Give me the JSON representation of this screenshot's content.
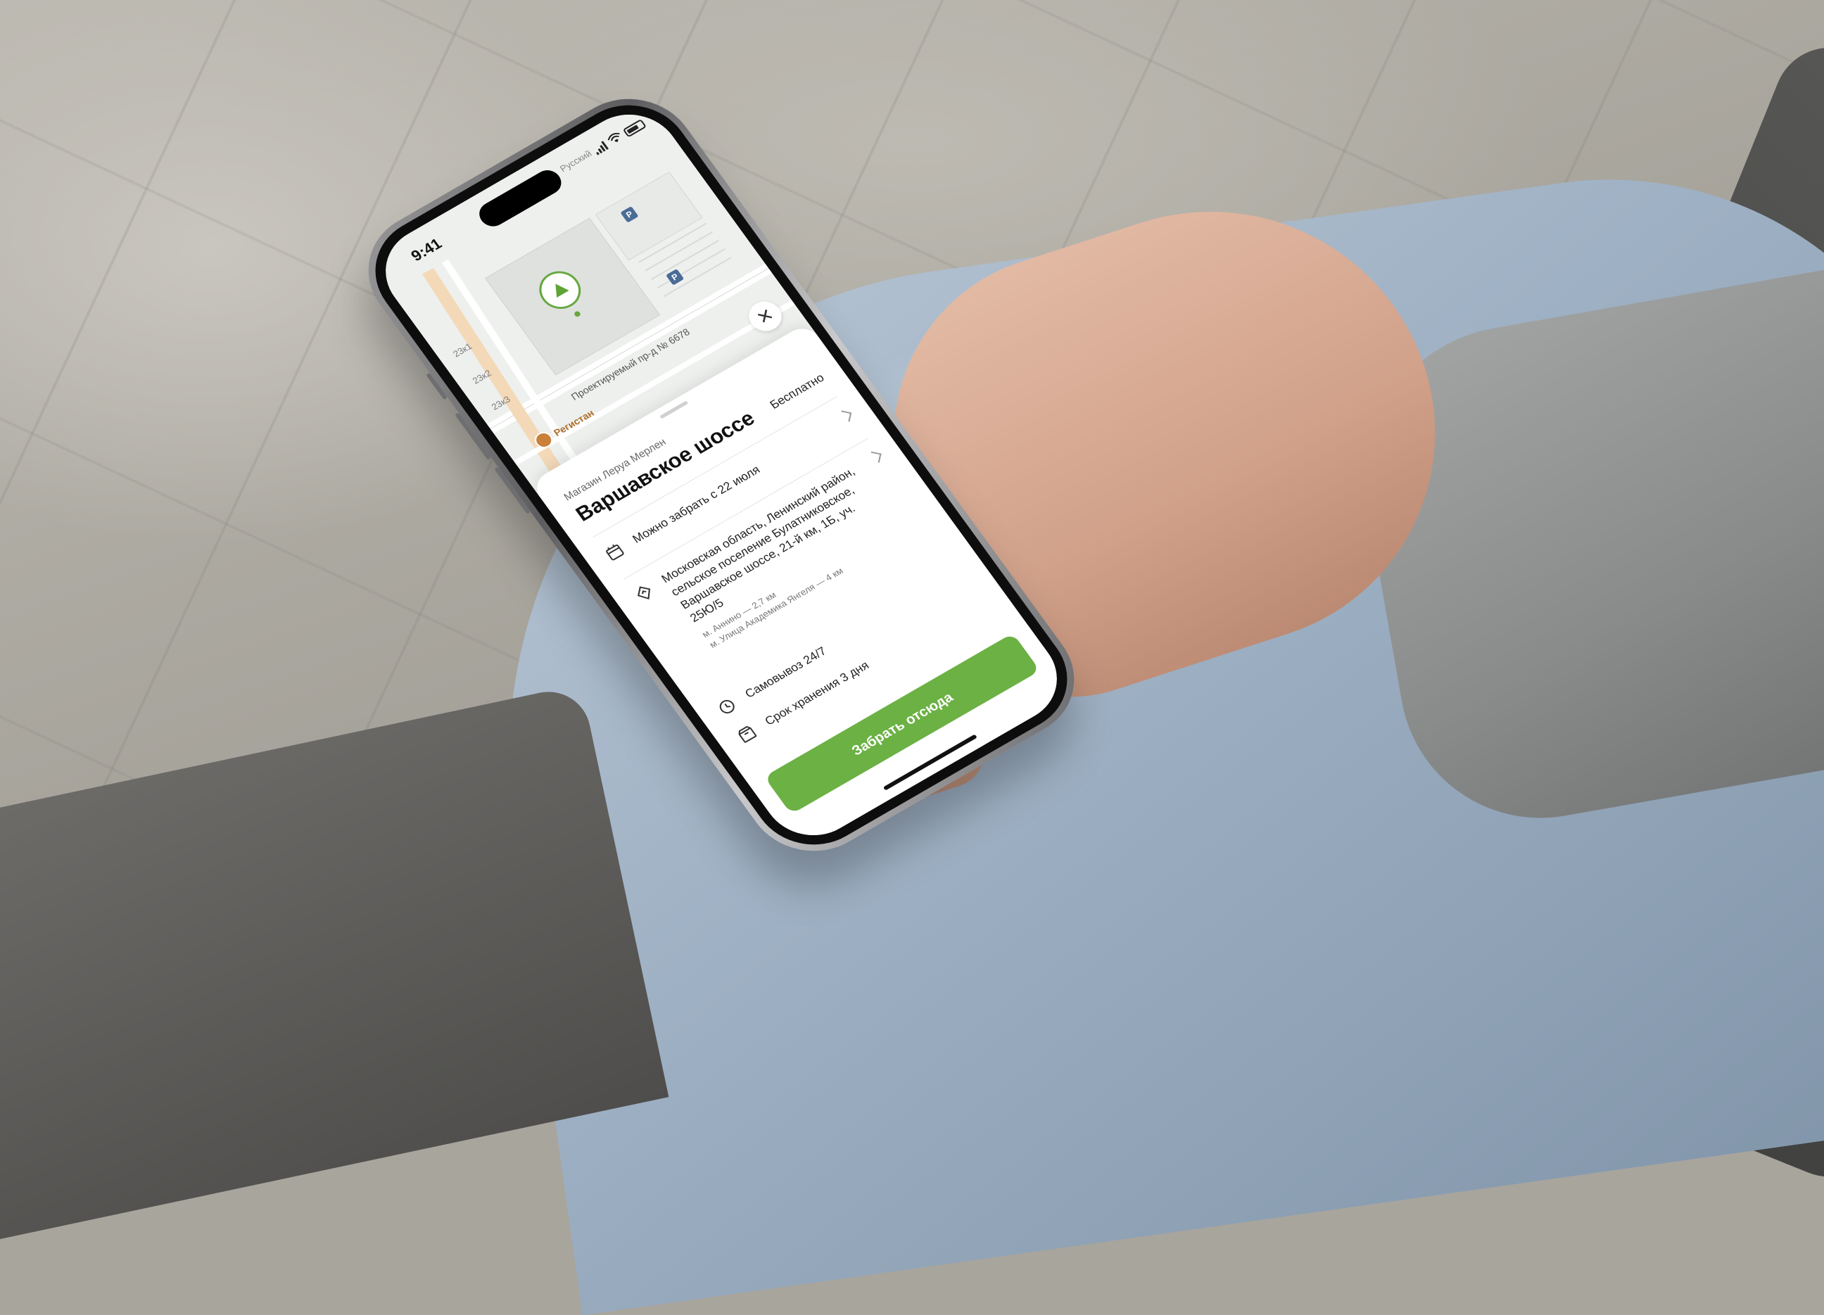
{
  "status_bar": {
    "time": "9:41",
    "carrier": "Русский"
  },
  "map": {
    "building_labels": [
      "23к1",
      "23к2",
      "23к3"
    ],
    "street_name": "Проектируемый пр-д № 6678",
    "poi": {
      "name": "Регистан",
      "icon": "restaurant-icon"
    },
    "parking_label": "P",
    "pin_icon": "leroy-merlin-logo-icon",
    "accent_color": "#66a83f"
  },
  "sheet": {
    "close_icon": "close-icon",
    "subtitle": "Магазин Леруа Мерлен",
    "title": "Варшавское шоссе",
    "price": "Бесплатно",
    "rows": [
      {
        "icon": "calendar-icon",
        "text": "Можно забрать с 22 июля",
        "has_chevron": true
      },
      {
        "icon": "location-pin-icon",
        "text": "Московская область, Ленинский район, сельское поселение Булатниковское, Варшавское шоссе, 21-й км, 1Б, уч. 25Ю/5",
        "metro": [
          "м. Аннино — 2,7 км",
          "м. Улица Академика Янгеля — 4 км"
        ],
        "has_chevron": true
      },
      {
        "icon": "clock-icon",
        "text": "Самовывоз 24/7",
        "has_chevron": false
      },
      {
        "icon": "storage-box-icon",
        "text": "Срок хранения 3 дня",
        "has_chevron": false
      }
    ],
    "primary_button": "Забрать отсюда",
    "primary_color": "#6bb144"
  }
}
